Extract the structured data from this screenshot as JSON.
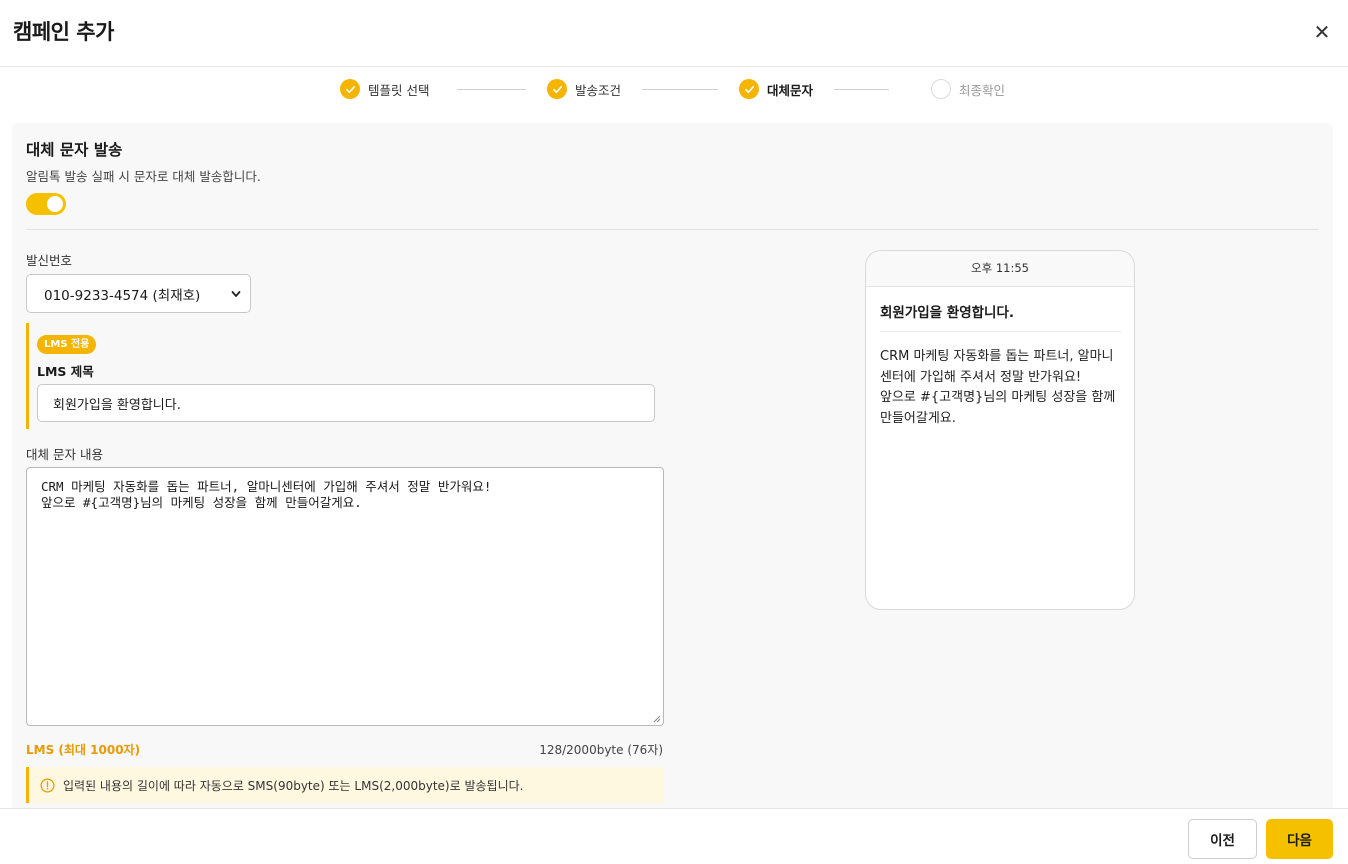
{
  "header": {
    "title": "캠페인 추가",
    "close_glyph": "✕"
  },
  "steps": [
    {
      "label": "템플릿 선택",
      "state": "done"
    },
    {
      "label": "발송조건",
      "state": "done"
    },
    {
      "label": "대체문자",
      "state": "active"
    },
    {
      "label": "최종확인",
      "state": "pending"
    }
  ],
  "section": {
    "title": "대체 문자 발송",
    "description": "알림톡 발송 실패 시 문자로 대체 발송합니다.",
    "toggle_on": true
  },
  "sender": {
    "label": "발신번호",
    "selected": "010-9233-4574 (최재호)"
  },
  "lms": {
    "badge": "LMS 전용",
    "title_label": "LMS 제목",
    "title_value": "회원가입을 환영합니다."
  },
  "content": {
    "label": "대체 문자 내용",
    "value": "CRM 마케팅 자동화를 돕는 파트너, 알마니센터에 가입해 주셔서 정말 반가워요!\n앞으로 #{고객명}님의 마케팅 성장을 함께 만들어갈게요.",
    "limit_label": "LMS (최대 1000자)",
    "byte_count": "128/2000byte (76자)",
    "notice": "입력된 내용의 길이에 따라 자동으로 SMS(90byte) 또는 LMS(2,000byte)로 발송됩니다."
  },
  "preview": {
    "time": "오후 11:55",
    "title": "회원가입을 환영합니다.",
    "body": "CRM 마케팅 자동화를 돕는 파트너, 알마니\n센터에 가입해 주셔서 정말 반가워요!\n앞으로 #{고객명}님의 마케팅 성장을 함께\n만들어갈게요."
  },
  "footer": {
    "prev_label": "이전",
    "next_label": "다음"
  },
  "colors": {
    "accent": "#f5b400",
    "notice_bg": "#fff8e0"
  },
  "icons": [
    "close-icon",
    "check-icon",
    "chevron-down-icon",
    "info-icon"
  ]
}
